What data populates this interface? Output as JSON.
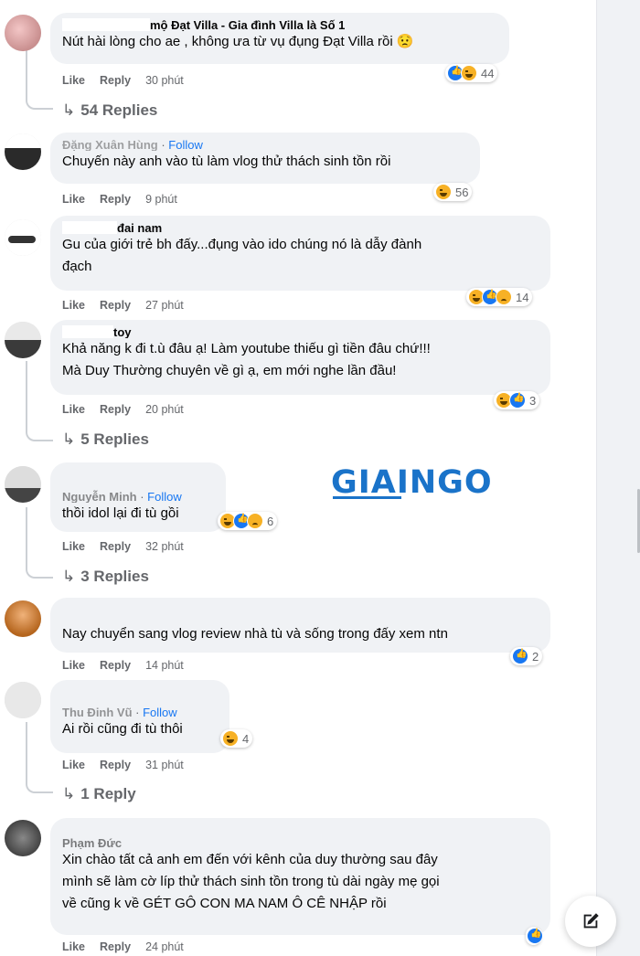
{
  "watermark": "GIAINGO",
  "colors": {
    "accent": "#1877f2",
    "bubble": "#f0f2f5",
    "meta": "#65676b"
  },
  "labels": {
    "like": "Like",
    "reply": "Reply",
    "follow": "Follow"
  },
  "comments": [
    {
      "name": "mộ Đạt Villa - Gia đình Villa là Số 1",
      "text1": "Nút hài lòng cho ae , không ưa từ vụ đụng Đạt Villa rồi 😟",
      "time": "30 phút",
      "reactions": [
        "like-icon",
        "haha-icon"
      ],
      "reaction_count": "44",
      "replies": "54 Replies"
    },
    {
      "name": "Đặng Xuân Hùng",
      "text1": "Chuyến này anh vào tù làm vlog thử thách sinh tồn rồi",
      "time": "9 phút",
      "reactions": [
        "haha-icon"
      ],
      "reaction_count": "56"
    },
    {
      "name": "đai nam",
      "text1": "Gu của giới trẻ bh đấy...đụng vào ido chúng nó là dẫy đành",
      "text2": "đạch",
      "time": "27 phút",
      "reactions": [
        "haha-icon",
        "like-icon",
        "sad-icon"
      ],
      "reaction_count": "14"
    },
    {
      "name": "toy",
      "text1": "Khả năng k đi t.ù đâu ạ! Làm youtube thiếu gì tiền đâu chứ!!!",
      "text2": "Mà Duy Thường chuyên về gì ạ, em mới nghe lần đầu!",
      "time": "20 phút",
      "reactions": [
        "haha-icon",
        "like-icon"
      ],
      "reaction_count": "3",
      "replies": "5 Replies"
    },
    {
      "name": "Nguyễn Minh",
      "text1": "thồi idol lại đi tù gồi",
      "time": "32 phút",
      "reactions": [
        "haha-icon",
        "like-icon",
        "sad-icon"
      ],
      "reaction_count": "6",
      "replies": "3 Replies"
    },
    {
      "name": "",
      "text1": "Nay chuyển sang vlog review nhà tù và sống trong đấy xem ntn",
      "time": "14 phút",
      "reactions": [
        "like-icon"
      ],
      "reaction_count": "2"
    },
    {
      "name": "Thu Đinh Vũ",
      "text1": "Ai rồi cũng đi tù thôi",
      "time": "31 phút",
      "reactions": [
        "haha-icon"
      ],
      "reaction_count": "4",
      "replies": "1 Reply"
    },
    {
      "name": "Phạm Đức",
      "text1": "Xin chào tất cả anh em đến với kênh của duy thường sau đây",
      "text2": "mình sẽ làm cờ líp thử thách sinh tồn trong tù dài ngày mẹ gọi",
      "text3": "về cũng k về GÉT GÔ CON MA NAM Ô CÊ NHẬP rồi",
      "time": "24 phút",
      "reactions": [
        "like-icon"
      ]
    }
  ],
  "compose": {
    "icon": "edit-icon"
  }
}
